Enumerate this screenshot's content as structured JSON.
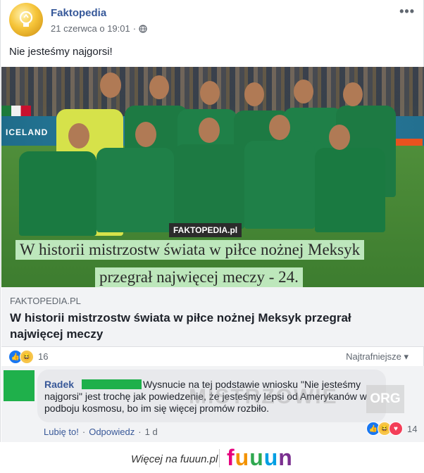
{
  "post": {
    "page_name": "Faktopedia",
    "date": "21 czerwca o 19:01",
    "separator": "·",
    "text": "Nie jesteśmy najgorsi!",
    "more": "•••"
  },
  "image": {
    "board_text": "ICELAND",
    "watermark": "FAKTOPEDIA.pl",
    "caption_line1": "W historii mistrzostw świata w piłce nożnej Meksyk",
    "caption_line2": "przegrał najwięcej meczy - 24."
  },
  "link": {
    "domain": "FAKTOPEDIA.PL",
    "title": "W historii mistrzostw świata w piłce nożnej Meksyk przegrał najwięcej meczy"
  },
  "reactions": {
    "count": "16",
    "sort_label": "Najtrafniejsze",
    "sort_arrow": "▾"
  },
  "comment": {
    "author": "Radek",
    "text": "Wysnucie na tej podstawie wniosku \"Nie jesteśmy najgorsi\" jest trochę jak powiedzenie, że jesteśmy lepsi od Amerykanów w podboju kosmosu, bo im się więcej promów rozbiło.",
    "watermark": "MISTRZOWIE",
    "watermark_org": "ORG",
    "reaction_count": "14",
    "like_label": "Lubię to!",
    "reply_label": "Odpowiedz",
    "time": "1 d",
    "dot": "·"
  },
  "footer": {
    "more_label": "Więcej na fuuun.pl",
    "logo_letters": [
      "f",
      "u",
      "u",
      "u",
      "n"
    ],
    "logo_colors": [
      "#e6007e",
      "#f39200",
      "#2fa84f",
      "#009fe3",
      "#7a2f8f"
    ]
  },
  "colors": {
    "link_blue": "#365899",
    "green_redaction": "#1fb04b"
  }
}
